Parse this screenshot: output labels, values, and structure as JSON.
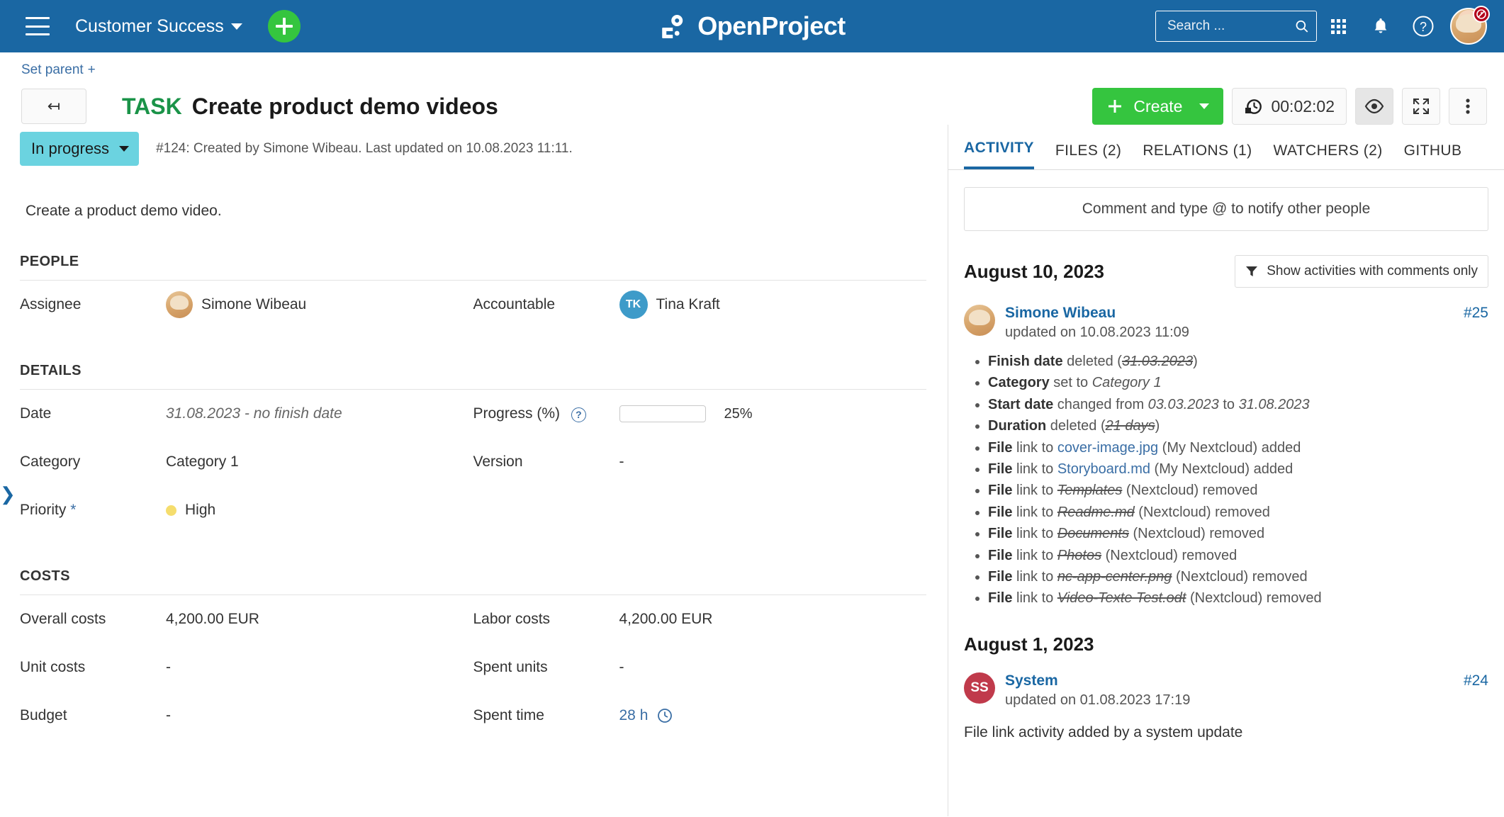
{
  "topbar": {
    "menu_icon": "hamburger-icon",
    "project_name": "Customer Success",
    "add_label": "+",
    "logo_text": "OpenProject",
    "search_placeholder": "Search ...",
    "search_value": "",
    "modules_icon": "grid-icon",
    "notifications_icon": "bell-icon",
    "help_icon": "question-icon",
    "avatar_icon": "user-avatar",
    "avatar_badge_icon": "clock-alert-icon"
  },
  "breadcrumb": {
    "set_parent_label": "Set parent",
    "set_parent_plus": "+"
  },
  "header": {
    "back_icon": "back-arrow-icon",
    "type": "TASK",
    "subject": "Create product demo videos",
    "create_label": "Create",
    "timer_icon": "timer-icon",
    "timer_value": "00:02:02",
    "watch_icon": "eye-icon",
    "fullscreen_icon": "fullscreen-icon",
    "more_icon": "more-vertical-icon"
  },
  "status": {
    "label": "In progress",
    "meta": "#124: Created by Simone Wibeau. Last updated on 10.08.2023 11:11."
  },
  "description": "Create a product demo video.",
  "sections": [
    {
      "title": "PEOPLE",
      "rows": [
        {
          "label": "Assignee",
          "value": "Simone Wibeau",
          "kind": "avatar"
        },
        {
          "label": "Accountable",
          "value": "Tina Kraft",
          "kind": "initials",
          "initials": "TK"
        }
      ]
    },
    {
      "title": "DETAILS",
      "rows": [
        {
          "label": "Date",
          "value": "31.08.2023 - no finish date",
          "kind": "italic"
        },
        {
          "label": "Progress (%)",
          "value": "25%",
          "kind": "progress",
          "percent": 25,
          "help": "?"
        },
        {
          "label": "Category",
          "value": "Category 1",
          "kind": "text"
        },
        {
          "label": "Version",
          "value": "-",
          "kind": "text"
        },
        {
          "label": "Priority",
          "value": "High",
          "kind": "priority",
          "required": "*"
        }
      ]
    },
    {
      "title": "COSTS",
      "rows": [
        {
          "label": "Overall costs",
          "value": "4,200.00 EUR",
          "kind": "text"
        },
        {
          "label": "Labor costs",
          "value": "4,200.00 EUR",
          "kind": "text"
        },
        {
          "label": "Unit costs",
          "value": "-",
          "kind": "text"
        },
        {
          "label": "Spent units",
          "value": "-",
          "kind": "text"
        },
        {
          "label": "Budget",
          "value": "-",
          "kind": "text"
        },
        {
          "label": "Spent time",
          "value": "28 h",
          "kind": "link-time"
        }
      ]
    }
  ],
  "right": {
    "tabs": [
      {
        "label": "ACTIVITY",
        "active": true
      },
      {
        "label": "FILES (2)",
        "active": false
      },
      {
        "label": "RELATIONS (1)",
        "active": false
      },
      {
        "label": "WATCHERS (2)",
        "active": false
      },
      {
        "label": "GITHUB",
        "active": false
      }
    ],
    "comment_placeholder": "Comment and type @ to notify other people",
    "groups": [
      {
        "date": "August 10, 2023",
        "filter_label": "Show activities with comments only",
        "entries": [
          {
            "user": "Simone Wibeau",
            "time": "updated on 10.08.2023 11:09",
            "number": "#25",
            "avatar_kind": "photo",
            "items": [
              {
                "bold": "Finish date",
                "mid": " deleted (",
                "strike": "31.03.2023",
                "tail": ")"
              },
              {
                "bold": "Category",
                "mid": " set to ",
                "italic": "Category 1",
                "tail": ""
              },
              {
                "bold": "Start date",
                "mid": " changed from ",
                "italic": "03.03.2023",
                "mid2": " to ",
                "italic2": "31.08.2023",
                "tail": ""
              },
              {
                "bold": "Duration",
                "mid": " deleted (",
                "strike": "21 days",
                "tail": ")"
              },
              {
                "bold": "File",
                "mid": " link to ",
                "link": "cover-image.jpg",
                "tail": " (My Nextcloud) added"
              },
              {
                "bold": "File",
                "mid": " link to ",
                "link": "Storyboard.md",
                "tail": " (My Nextcloud) added"
              },
              {
                "bold": "File",
                "mid": " link to ",
                "strike": "Templates",
                "tail": " (Nextcloud) removed"
              },
              {
                "bold": "File",
                "mid": " link to ",
                "strike": "Readme.md",
                "tail": " (Nextcloud) removed"
              },
              {
                "bold": "File",
                "mid": " link to ",
                "strike": "Documents",
                "tail": " (Nextcloud) removed"
              },
              {
                "bold": "File",
                "mid": " link to ",
                "strike": "Photos",
                "tail": " (Nextcloud) removed"
              },
              {
                "bold": "File",
                "mid": " link to ",
                "strike": "nc-app-center.png",
                "tail": " (Nextcloud) removed"
              },
              {
                "bold": "File",
                "mid": " link to ",
                "strike": "Video-Texte Test.odt",
                "tail": " (Nextcloud) removed"
              }
            ]
          }
        ]
      },
      {
        "date": "August 1, 2023",
        "entries": [
          {
            "user": "System",
            "time": "updated on 01.08.2023 17:19",
            "number": "#24",
            "avatar_kind": "initials",
            "initials": "SS",
            "body": "File link activity added by a system update"
          }
        ]
      }
    ]
  },
  "colors": {
    "brand_blue": "#1A67A3",
    "green": "#35C53F",
    "status_teal": "#6BD3E0",
    "type_green": "#1A9348",
    "link_blue": "#3A6EA5",
    "priority_yellow": "#F5DD6D"
  }
}
